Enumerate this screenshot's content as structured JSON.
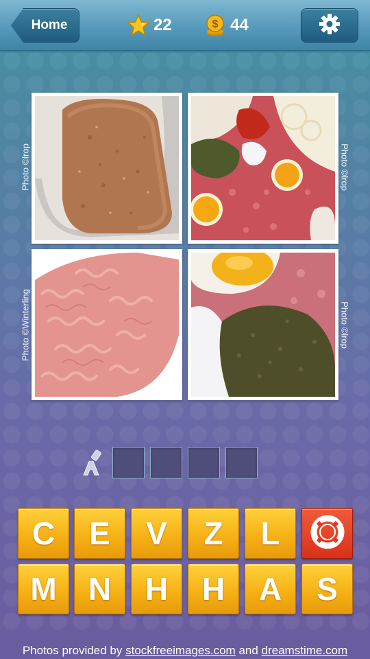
{
  "header": {
    "home_label": "Home",
    "stars_count": "22",
    "coins_count": "44",
    "coin_symbol": "$"
  },
  "photos": [
    {
      "credit": "Photo ©lrop",
      "subject": "meatloaf"
    },
    {
      "credit": "Photo ©lrop",
      "subject": "minced-meat-with-eggs-and-spices"
    },
    {
      "credit": "Photo ©Winterling",
      "subject": "raw-minced-meat"
    },
    {
      "credit": "Photo ©lrop",
      "subject": "minced-meat-with-egg-and-herbs"
    }
  ],
  "answer": {
    "slots": [
      "",
      "",
      "",
      ""
    ]
  },
  "letters": {
    "row1": [
      "C",
      "E",
      "V",
      "Z",
      "L"
    ],
    "row2": [
      "M",
      "N",
      "H",
      "H",
      "A",
      "S"
    ]
  },
  "footer": {
    "prefix": "Photos provided by ",
    "link1": "stockfreeimages.com",
    "middle": " and ",
    "link2": "dreamstime.com"
  },
  "colors": {
    "tile_gold": "#f6b216",
    "help_red": "#d9321a",
    "header_blue": "#5a9cbd"
  }
}
